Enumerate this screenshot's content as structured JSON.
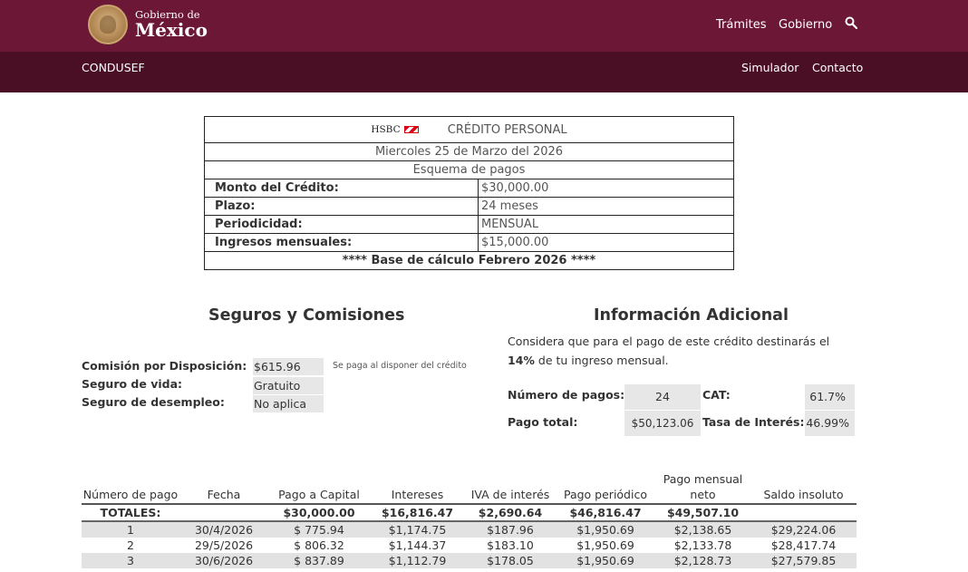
{
  "header": {
    "logo_small": "Gobierno de",
    "logo_big": "México",
    "nav": [
      "Trámites",
      "Gobierno"
    ],
    "search_icon": "search-icon"
  },
  "subheader": {
    "brand": "CONDUSEF",
    "nav": [
      "Simulador",
      "Contacto"
    ]
  },
  "summary": {
    "bank": "HSBC",
    "title": "CRÉDITO PERSONAL",
    "date": "Miercoles 25 de Marzo del 2026",
    "scheme": "Esquema de pagos",
    "rows": [
      {
        "label": "Monto del Crédito:",
        "value": "$30,000.00"
      },
      {
        "label": "Plazo:",
        "value": "24 meses"
      },
      {
        "label": "Periodicidad:",
        "value": "MENSUAL"
      },
      {
        "label": "Ingresos mensuales:",
        "value": "$15,000.00"
      }
    ],
    "footer": "**** Base de cálculo Febrero 2026 ****"
  },
  "seguros": {
    "title": "Seguros y Comisiones",
    "items": [
      {
        "label": "Comisión por Disposición:",
        "value": "$615.96"
      },
      {
        "label": "Seguro de vida:",
        "value": "Gratuito"
      },
      {
        "label": "Seguro de desempleo:",
        "value": "No aplica"
      }
    ],
    "note": "Se paga al disponer del crédito"
  },
  "info": {
    "title": "Información Adicional",
    "text_before": "Considera que para el pago de este crédito destinarás el ",
    "text_pct": "14%",
    "text_after": " de tu ingreso mensual.",
    "num_pagos_label": "Número de pagos:",
    "num_pagos": "24",
    "cat_label": "CAT:",
    "cat": "61.7%",
    "pago_total_label": "Pago total:",
    "pago_total": "$50,123.06",
    "tasa_label": "Tasa de Interés:",
    "tasa": "46.99%"
  },
  "payments": {
    "headers": [
      "Número de pago",
      "Fecha",
      "Pago a Capital",
      "Intereses",
      "IVA de interés",
      "Pago periódico",
      "Pago mensual neto",
      "Saldo insoluto"
    ],
    "totals": [
      "TOTALES:",
      "",
      "$30,000.00",
      "$16,816.47",
      "$2,690.64",
      "$46,816.47",
      "$49,507.10",
      ""
    ],
    "rows": [
      [
        "1",
        "30/4/2026",
        "$ 775.94",
        "$1,174.75",
        "$187.96",
        "$1,950.69",
        "$2,138.65",
        "$29,224.06"
      ],
      [
        "2",
        "29/5/2026",
        "$ 806.32",
        "$1,144.37",
        "$183.10",
        "$1,950.69",
        "$2,133.78",
        "$28,417.74"
      ],
      [
        "3",
        "30/6/2026",
        "$ 837.89",
        "$1,112.79",
        "$178.05",
        "$1,950.69",
        "$2,128.73",
        "$27,579.85"
      ]
    ]
  },
  "colors": {
    "topbar": "#6c1735",
    "subbar": "#4a0f25"
  }
}
